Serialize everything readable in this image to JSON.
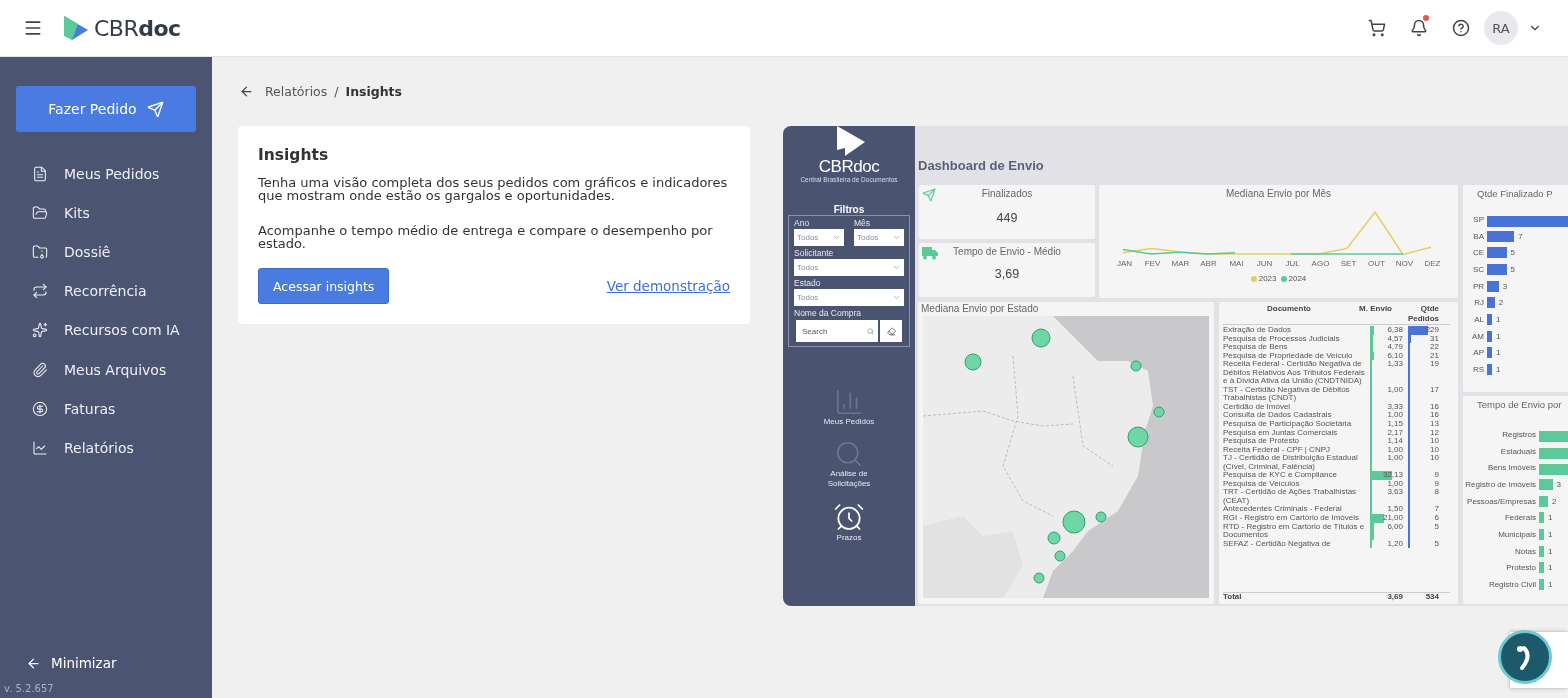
{
  "header": {
    "logo": "CBR**doc**",
    "avatar": "RA",
    "notification_dot": true
  },
  "sidebar": {
    "cta": "Fazer Pedido",
    "items": [
      {
        "label": "Meus Pedidos",
        "selected": false
      },
      {
        "label": "Kits",
        "selected": false
      },
      {
        "label": "Dossiê",
        "selected": false
      },
      {
        "label": "Recorrência",
        "selected": false
      },
      {
        "label": "Recursos com IA",
        "selected": false
      },
      {
        "label": "Meus Arquivos",
        "selected": false
      },
      {
        "label": "Faturas",
        "selected": false
      },
      {
        "label": "Relatórios",
        "selected": false
      }
    ],
    "minimize": "Minimizar",
    "version": "v. 5.2.657"
  },
  "breadcrumb": {
    "parent": "Relatórios",
    "separator": "/",
    "current": "Insights"
  },
  "insights": {
    "title": "Insights",
    "paragraphs": [
      "Tenha uma visão completa dos seus pedidos com gráficos e indicadores que mostram onde estão os gargalos e oportunidades.",
      "Acompanhe o tempo médio de entrega e compare o desempenho por estado."
    ],
    "button": "Acessar insights",
    "link": "Ver demonstração"
  },
  "dashboard": {
    "logo": "CBRdoc",
    "logo_subtitle": "Central Brasileira de Documentos",
    "filters_title": "Filtros",
    "filters": [
      {
        "label": "Ano",
        "value": "Todos"
      },
      {
        "label": "Mês",
        "value": "Todos"
      },
      {
        "label": "Solicitante",
        "value": "Todos"
      },
      {
        "label": "Estado",
        "value": "Todos"
      }
    ],
    "search": {
      "label": "Nome da Compra",
      "placeholder": "Search"
    },
    "nav": [
      {
        "label": "Meus Pedidos"
      },
      {
        "label": "Análise de Solicitações"
      },
      {
        "label": "Prazos"
      }
    ],
    "title": "Dashboard de Envio",
    "kpis": [
      {
        "label": "Finalizados",
        "value": "449"
      },
      {
        "label": "Tempo de Envio - Médio",
        "value": "3,69"
      }
    ],
    "line_chart": {
      "title": "Mediana Envio por Mês",
      "months": [
        "JAN",
        "FEV",
        "MAR",
        "ABR",
        "MAI",
        "JUN",
        "JUL",
        "AGO",
        "SET",
        "OUT",
        "NOV",
        "DEZ"
      ],
      "legend": [
        {
          "label": "2023",
          "color": "#e3cf5e"
        },
        {
          "label": "2024",
          "color": "#5cc99a"
        }
      ]
    },
    "map": {
      "title": "Mediana Envio por Estado",
      "kind": "picture"
    },
    "table": {
      "columns": [
        "Documento",
        "M. Envio",
        "Qtde Pedidos"
      ],
      "rows": [
        {
          "documento": "Extração de Dados",
          "m_envio": "6,38",
          "qtde": "229"
        },
        {
          "documento": "Pesquisa de Processos Judiciais",
          "m_envio": "4,57",
          "qtde": "31"
        },
        {
          "documento": "Pesquisa de Bens",
          "m_envio": "4,79",
          "qtde": "22"
        },
        {
          "documento": "Pesquisa de Propriedade de Veículo",
          "m_envio": "6,10",
          "qtde": "21"
        },
        {
          "documento": "Receita Federal - Certidão Negativa de Débitos Relativos Aos Tributos Federais e à Dívida Ativa da União (CNDTNIDA)",
          "m_envio": "1,33",
          "qtde": "19"
        },
        {
          "documento": "TST - Certidão Negativa de Débitos Trabalhistas (CNDT)",
          "m_envio": "1,00",
          "qtde": "17"
        },
        {
          "documento": "Certidão de Imóvel",
          "m_envio": "3,33",
          "qtde": "16"
        },
        {
          "documento": "Consulta de Dados Cadastrais",
          "m_envio": "1,00",
          "qtde": "16"
        },
        {
          "documento": "Pesquisa de Participação Societária",
          "m_envio": "1,15",
          "qtde": "13"
        },
        {
          "documento": "Pesquisa em Juntas Comerciais",
          "m_envio": "2,17",
          "qtde": "12"
        },
        {
          "documento": "Pesquisa de Protesto",
          "m_envio": "1,14",
          "qtde": "10"
        },
        {
          "documento": "Receita Federal - CPF | CNPJ",
          "m_envio": "1,00",
          "qtde": "10"
        },
        {
          "documento": "TJ - Certidão de Distribuição Estadual (Cível, Criminal, Falência)",
          "m_envio": "1,00",
          "qtde": "10"
        },
        {
          "documento": "Pesquisa de KYC e Compliance",
          "m_envio": "32,13",
          "qtde": "9"
        },
        {
          "documento": "Pesquisa de Veículos",
          "m_envio": "1,00",
          "qtde": "9"
        },
        {
          "documento": "TRT - Certidão de Ações Trabalhistas (CEAT)",
          "m_envio": "3,63",
          "qtde": "8"
        },
        {
          "documento": "Antecedentes Criminais - Federal",
          "m_envio": "1,50",
          "qtde": "7"
        },
        {
          "documento": "RGI - Registro em Cartório de Imóveis",
          "m_envio": "21,00",
          "qtde": "6"
        },
        {
          "documento": "RTD - Registro em Cartório de Títulos e Documentos",
          "m_envio": "6,00",
          "qtde": "5"
        },
        {
          "documento": "SEFAZ - Certidão Negativa de",
          "m_envio": "1,20",
          "qtde": "5"
        }
      ],
      "total": {
        "documento": "Total",
        "m_envio": "3,69",
        "qtde": "534"
      }
    },
    "bar_charts": [
      {
        "chart_data": {
          "type": "bar",
          "orientation": "horizontal",
          "title": "Qtde Finalizado P",
          "categories": [
            "SP",
            "BA",
            "CE",
            "SC",
            "PR",
            "RJ",
            "AL",
            "AM",
            "AP",
            "RS"
          ],
          "series": [
            {
              "color": "#4a73d6",
              "values": [
                null,
                7,
                5,
                5,
                3,
                2,
                1,
                1,
                1,
                1
              ]
            }
          ],
          "data_labels": true
        }
      },
      {
        "chart_data": {
          "type": "bar",
          "orientation": "horizontal",
          "title": "Tempo de Envio por",
          "categories": [
            "Registros",
            "Estaduais",
            "Bens Imóveis",
            "Registro de Imóveis",
            "Pessoas/Empresas",
            "Federais",
            "Municipais",
            "Notas",
            "Protesto",
            "Registro Civil"
          ],
          "series": [
            {
              "color": "#5cc99a",
              "values": [
                null,
                null,
                null,
                3,
                2,
                1,
                1,
                1,
                1,
                1
              ]
            }
          ],
          "data_labels": true
        }
      }
    ]
  }
}
